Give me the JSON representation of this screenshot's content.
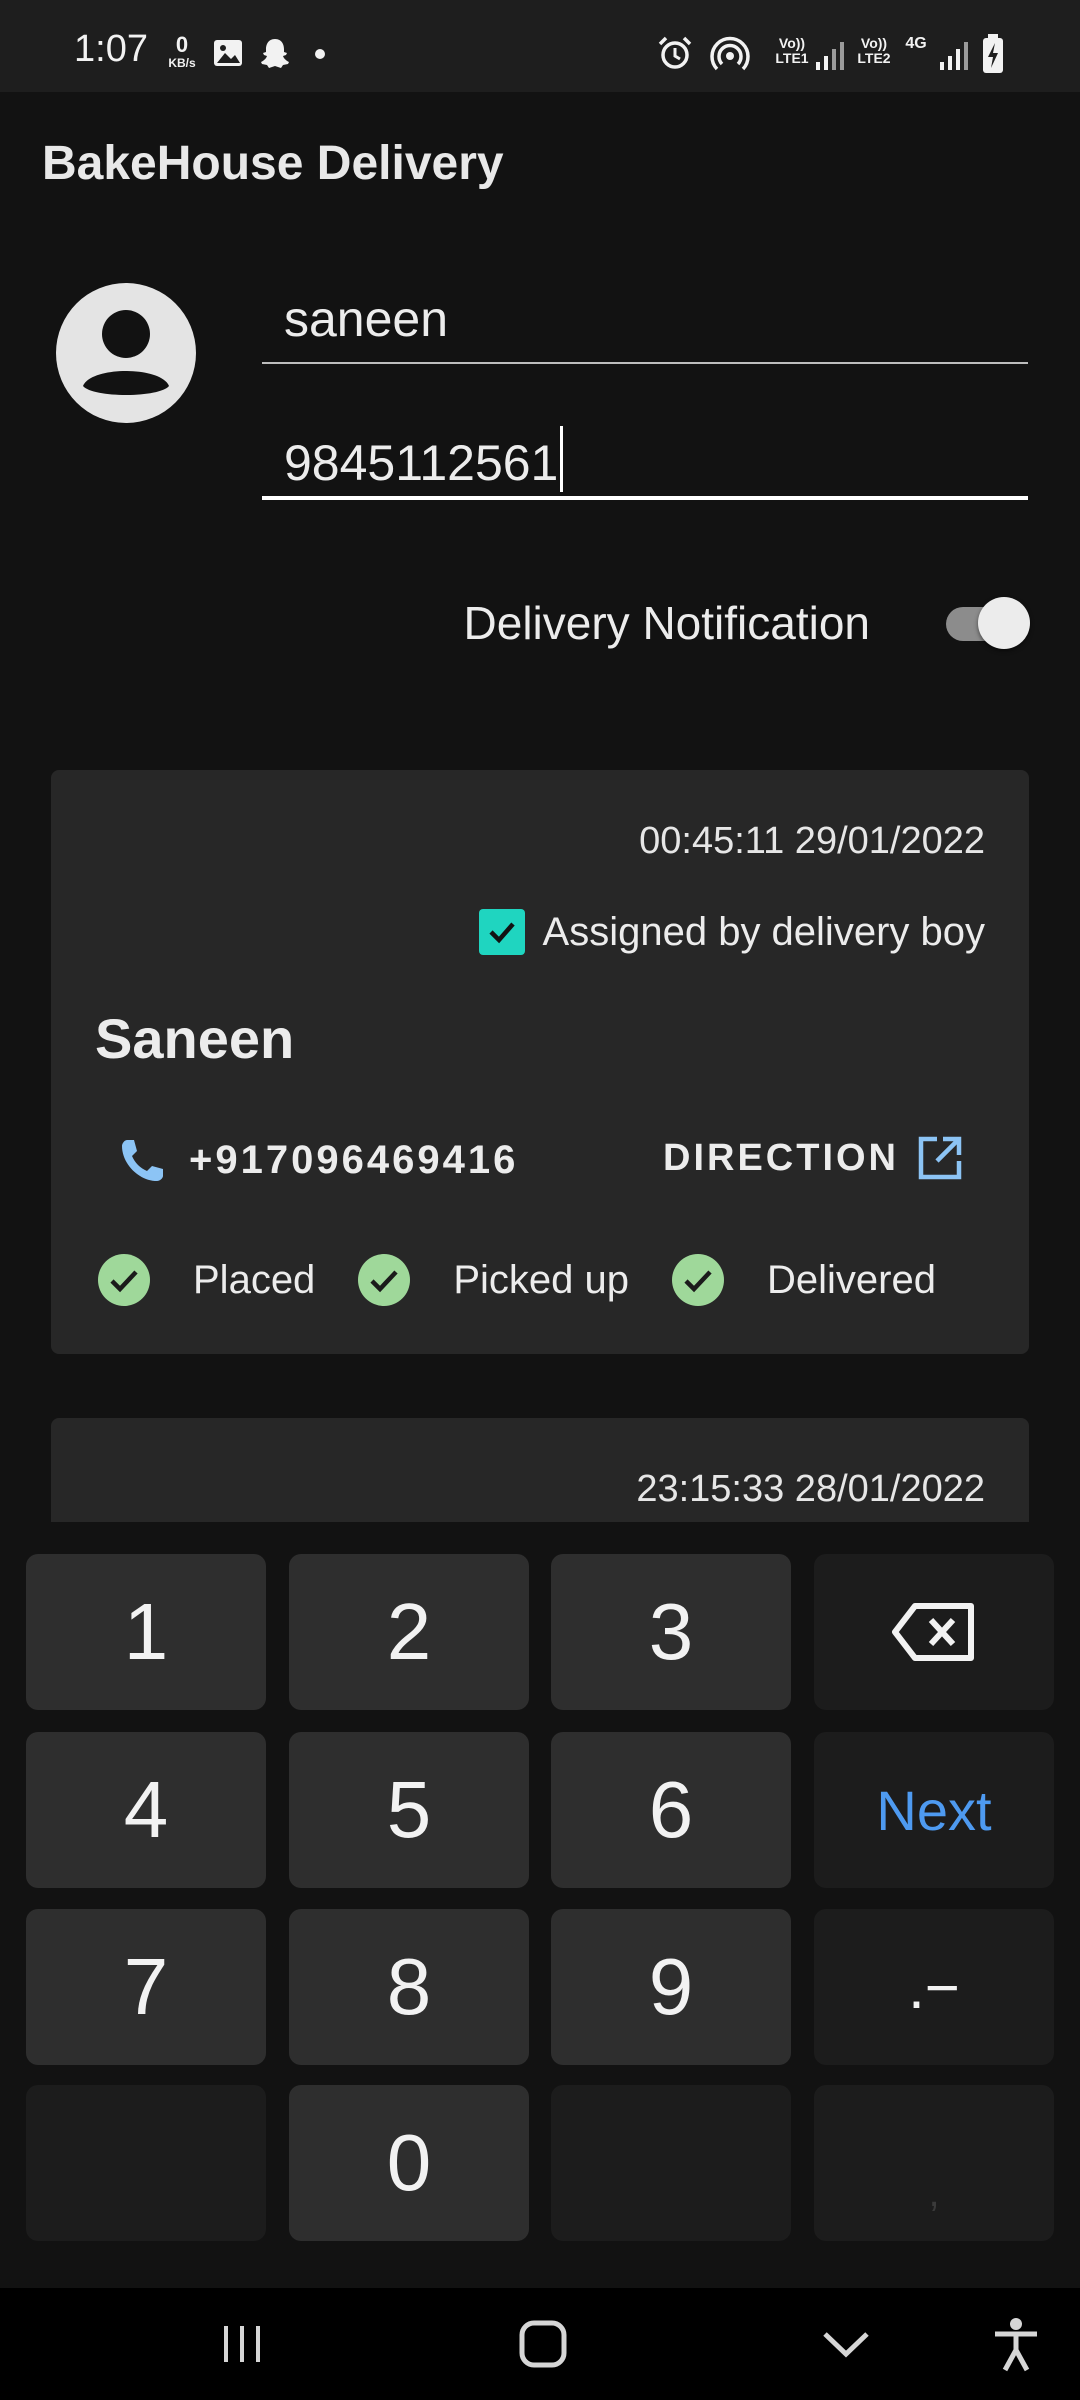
{
  "status_bar": {
    "time": "1:07",
    "net_speed": "0",
    "net_speed_unit": "KB/s",
    "sim1": "Vo))\nLTE1",
    "sim2": "Vo))\nLTE2",
    "network_type": "4G",
    "icons": [
      "image-icon",
      "snapchat-icon",
      "dot-icon",
      "alarm-icon",
      "hotspot-icon",
      "signal-icon",
      "battery-charging-icon"
    ]
  },
  "app": {
    "title": "BakeHouse Delivery"
  },
  "profile": {
    "name_value": "saneen",
    "phone_value": "9845112561",
    "notification_label": "Delivery Notification",
    "notification_enabled": true
  },
  "orders": [
    {
      "timestamp": "00:45:11 29/01/2022",
      "assigned_label": "Assigned by delivery boy",
      "assigned_checked": true,
      "customer_name": "Saneen",
      "phone": "+917096469416",
      "direction_label": "DIRECTION",
      "steps": [
        {
          "label": "Placed",
          "done": true
        },
        {
          "label": "Picked up",
          "done": true
        },
        {
          "label": "Delivered",
          "done": true
        }
      ]
    },
    {
      "timestamp": "23:15:33 28/01/2022"
    }
  ],
  "keyboard": {
    "keys": [
      "1",
      "2",
      "3",
      "4",
      "5",
      "6",
      "7",
      "8",
      "9",
      "0"
    ],
    "next_label": "Next",
    "symbols_label": ".−",
    "comma_label": ","
  },
  "colors": {
    "accent_teal": "#1fd5c0",
    "check_green": "#9fd89a",
    "link_blue": "#4e9af0",
    "background": "#121212",
    "card": "#272727"
  }
}
